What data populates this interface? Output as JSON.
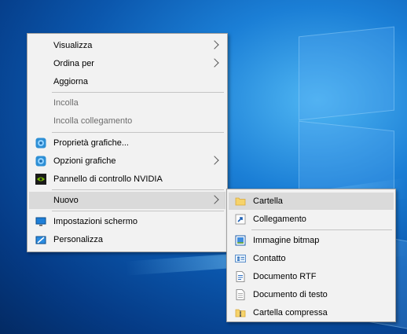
{
  "context_menu": {
    "items": [
      {
        "label": "Visualizza"
      },
      {
        "label": "Ordina per"
      },
      {
        "label": "Aggiorna"
      },
      {
        "label": "Incolla"
      },
      {
        "label": "Incolla collegamento"
      },
      {
        "label": "Proprietà grafiche..."
      },
      {
        "label": "Opzioni grafiche"
      },
      {
        "label": "Pannello di controllo NVIDIA"
      },
      {
        "label": "Nuovo"
      },
      {
        "label": "Impostazioni schermo"
      },
      {
        "label": "Personalizza"
      }
    ]
  },
  "submenu_nuovo": {
    "items": [
      {
        "label": "Cartella"
      },
      {
        "label": "Collegamento"
      },
      {
        "label": "Immagine bitmap"
      },
      {
        "label": "Contatto"
      },
      {
        "label": "Documento RTF"
      },
      {
        "label": "Documento di testo"
      },
      {
        "label": "Cartella compressa"
      }
    ]
  },
  "colors": {
    "menu_bg": "#f2f2f2",
    "highlight": "#dadada",
    "disabled_text": "#6d6d6d",
    "desktop_blue": "#0b57ad"
  }
}
